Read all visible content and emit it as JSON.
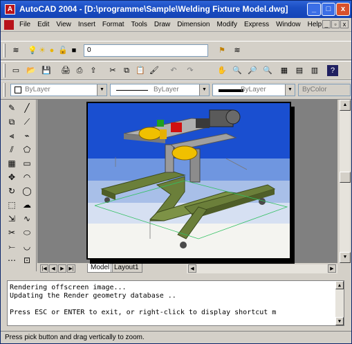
{
  "window": {
    "title": "AutoCAD 2004 - [D:\\programme\\Sample\\Welding Fixture Model.dwg]",
    "buttons": {
      "minimize": "_",
      "maximize": "□",
      "close": "x"
    }
  },
  "menubar": {
    "items": [
      "File",
      "Edit",
      "View",
      "Insert",
      "Format",
      "Tools",
      "Draw",
      "Dimension",
      "Modify",
      "Express",
      "Window",
      "Help"
    ],
    "mdi_buttons": {
      "minimize": "_",
      "restore": "▫",
      "close": "x"
    }
  },
  "layers_toolbar": {
    "current_layer": "0"
  },
  "properties_toolbar": {
    "color": "ByLayer",
    "linetype": "ByLayer",
    "lineweight": "ByLayer",
    "plotstyle": "ByColor"
  },
  "tabs": {
    "model": "Model",
    "layout1": "Layout1"
  },
  "command": {
    "lines": [
      "Rendering offscreen image...",
      "Updating the Render geometry database ..",
      "",
      "Press ESC or ENTER to exit, or right-click to display shortcut m"
    ]
  },
  "status": {
    "text": "Press pick button and drag vertically to zoom."
  },
  "colors": {
    "titlebar": "#1b4fc4",
    "render_sky": "#1a4fd0",
    "render_floor": "#c8d4ee",
    "frame_green": "#6b7f3a",
    "part_yellow": "#f0c000"
  }
}
